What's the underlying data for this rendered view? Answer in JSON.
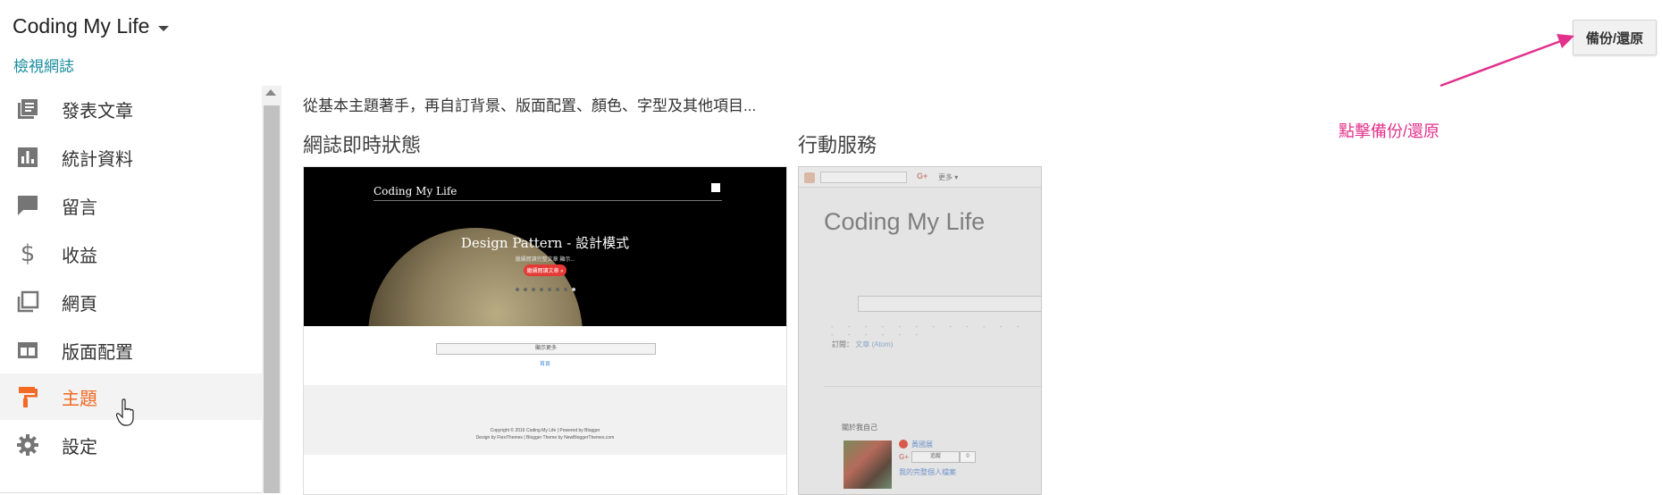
{
  "header": {
    "blog_title": "Coding My Life",
    "view_blog": "檢視網誌"
  },
  "actions": {
    "backup_restore": "備份/還原"
  },
  "annotation": {
    "text": "點擊備份/還原",
    "color": "#e2318b"
  },
  "sidebar": {
    "items": [
      {
        "label": "發表文章",
        "icon": "posts-icon"
      },
      {
        "label": "統計資料",
        "icon": "stats-icon"
      },
      {
        "label": "留言",
        "icon": "comments-icon"
      },
      {
        "label": "收益",
        "icon": "earnings-icon"
      },
      {
        "label": "網頁",
        "icon": "pages-icon"
      },
      {
        "label": "版面配置",
        "icon": "layout-icon"
      },
      {
        "label": "主題",
        "icon": "theme-icon",
        "active": true
      },
      {
        "label": "設定",
        "icon": "settings-icon"
      }
    ],
    "active_color": "#f26a24"
  },
  "main": {
    "intro": "從基本主題著手，再自訂背景、版面配置、顏色、字型及其他項目...",
    "live_title": "網誌即時狀態",
    "mobile_title": "行動服務",
    "live_preview": {
      "blog_title": "Coding My Life",
      "post_title": "Design Pattern - 設計模式",
      "post_sub": "繼續閱讀完整文章 顯示...",
      "read_more": "繼續閱讀文章 »",
      "search_bar": "顯示更多",
      "link": "首頁",
      "copyright": "Copyright © 2016 Coding My Life | Powered by Blogger",
      "design_credit": "Design by FlexiThemes | Blogger Theme by NewBloggerThemes.com"
    },
    "mobile_preview": {
      "gplus": "G+",
      "more": "更多 ▾",
      "blog_title": "Coding My Life",
      "subscribe_label": "訂閱：",
      "subscribe_link": "文章 (Atom)",
      "about_title": "關於我自己",
      "profile_name": "黃國展",
      "follow": "追蹤",
      "follow_count": "0",
      "profile_link": "我的完整個人檔案"
    }
  }
}
